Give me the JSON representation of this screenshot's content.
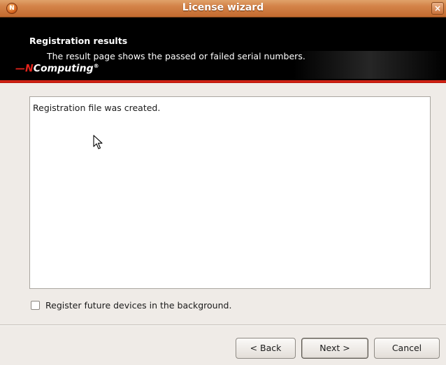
{
  "window": {
    "title": "License wizard",
    "close_glyph": "×",
    "app_icon": "nc-app-icon"
  },
  "banner": {
    "heading": "Registration results",
    "subheading": "The result page shows the passed or failed serial numbers.",
    "logo": {
      "mark": "—N",
      "text": "Computing",
      "reg": "®"
    },
    "accent_color": "#e02a1a"
  },
  "results": {
    "message": "Registration file was created."
  },
  "options": {
    "register_background_label": "Register future devices in the background.",
    "register_background_checked": false
  },
  "buttons": {
    "back": "< Back",
    "next": "Next >",
    "cancel": "Cancel"
  }
}
